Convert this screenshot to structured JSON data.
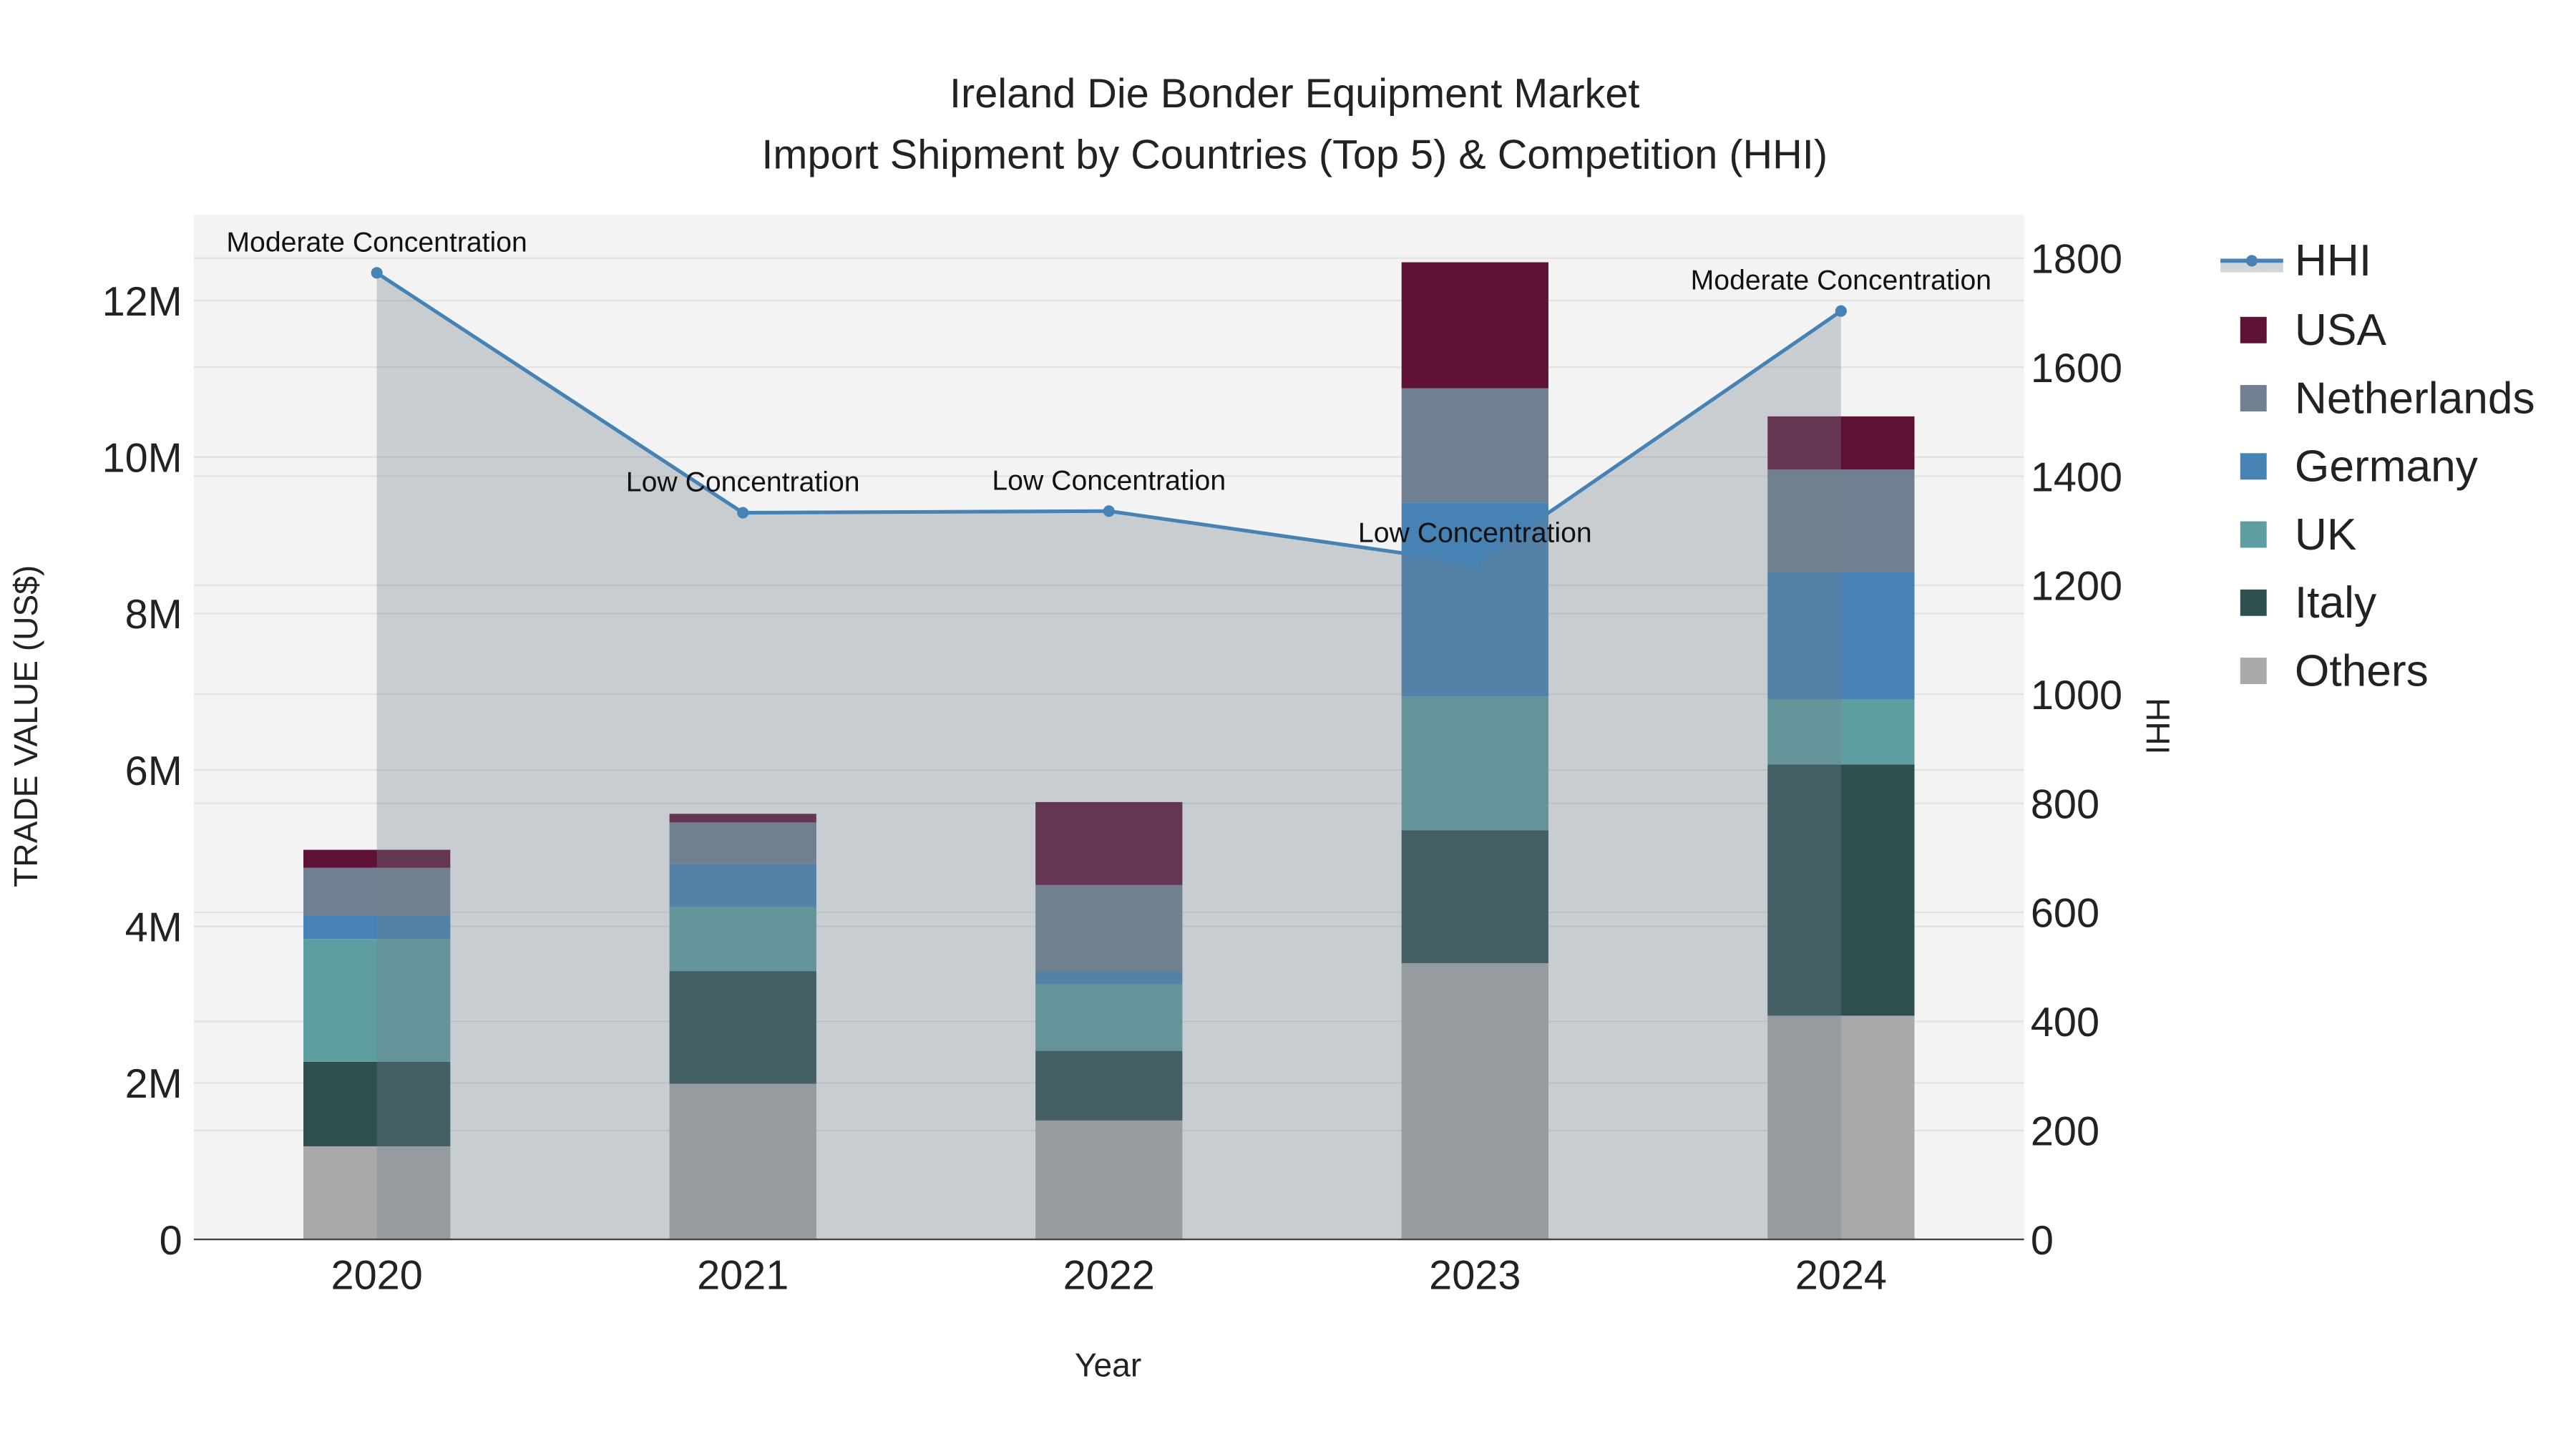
{
  "chart_data": {
    "type": "bar",
    "title_line1": "Ireland Die Bonder Equipment Market",
    "title_line2": "Import Shipment by Countries (Top 5) & Competition (HHI)",
    "xlabel": "Year",
    "ylabel": "TRADE VALUE (US$)",
    "y2label": "HHI",
    "categories": [
      "2020",
      "2021",
      "2022",
      "2023",
      "2024"
    ],
    "ylim": [
      0,
      13100000
    ],
    "y2lim": [
      0,
      1880
    ],
    "yticks": [
      {
        "v": 0,
        "label": "0"
      },
      {
        "v": 2000000,
        "label": "2M"
      },
      {
        "v": 4000000,
        "label": "4M"
      },
      {
        "v": 6000000,
        "label": "6M"
      },
      {
        "v": 8000000,
        "label": "8M"
      },
      {
        "v": 10000000,
        "label": "10M"
      },
      {
        "v": 12000000,
        "label": "12M"
      }
    ],
    "y2ticks": [
      {
        "v": 0,
        "label": "0"
      },
      {
        "v": 200,
        "label": "200"
      },
      {
        "v": 400,
        "label": "400"
      },
      {
        "v": 600,
        "label": "600"
      },
      {
        "v": 800,
        "label": "800"
      },
      {
        "v": 1000,
        "label": "1000"
      },
      {
        "v": 1200,
        "label": "1200"
      },
      {
        "v": 1400,
        "label": "1400"
      },
      {
        "v": 1600,
        "label": "1600"
      },
      {
        "v": 1800,
        "label": "1800"
      }
    ],
    "series": [
      {
        "name": "Others",
        "color": "#a9a9a9",
        "values": [
          1190000,
          1990000,
          1520000,
          3530000,
          2860000
        ]
      },
      {
        "name": "Italy",
        "color": "#2f4f4f",
        "values": [
          1080000,
          1440000,
          890000,
          1700000,
          3210000
        ]
      },
      {
        "name": "UK",
        "color": "#5f9ea0",
        "values": [
          1570000,
          820000,
          850000,
          1710000,
          830000
        ]
      },
      {
        "name": "Germany",
        "color": "#4682b4",
        "values": [
          300000,
          550000,
          170000,
          2480000,
          1630000
        ]
      },
      {
        "name": "Netherlands",
        "color": "#708090",
        "values": [
          610000,
          530000,
          1100000,
          1460000,
          1310000
        ]
      },
      {
        "name": "USA",
        "color": "#5e1235",
        "values": [
          230000,
          110000,
          1060000,
          1610000,
          680000
        ]
      }
    ],
    "hhi": {
      "name": "HHI",
      "color": "#4682b4",
      "values": [
        1773,
        1333,
        1336,
        1240,
        1703
      ],
      "annotations": [
        "Moderate Concentration",
        "Low Concentration",
        "Low Concentration",
        "Low Concentration",
        "Moderate Concentration"
      ]
    },
    "legend": [
      "HHI",
      "USA",
      "Netherlands",
      "Germany",
      "UK",
      "Italy",
      "Others"
    ],
    "legend_position": "right"
  }
}
